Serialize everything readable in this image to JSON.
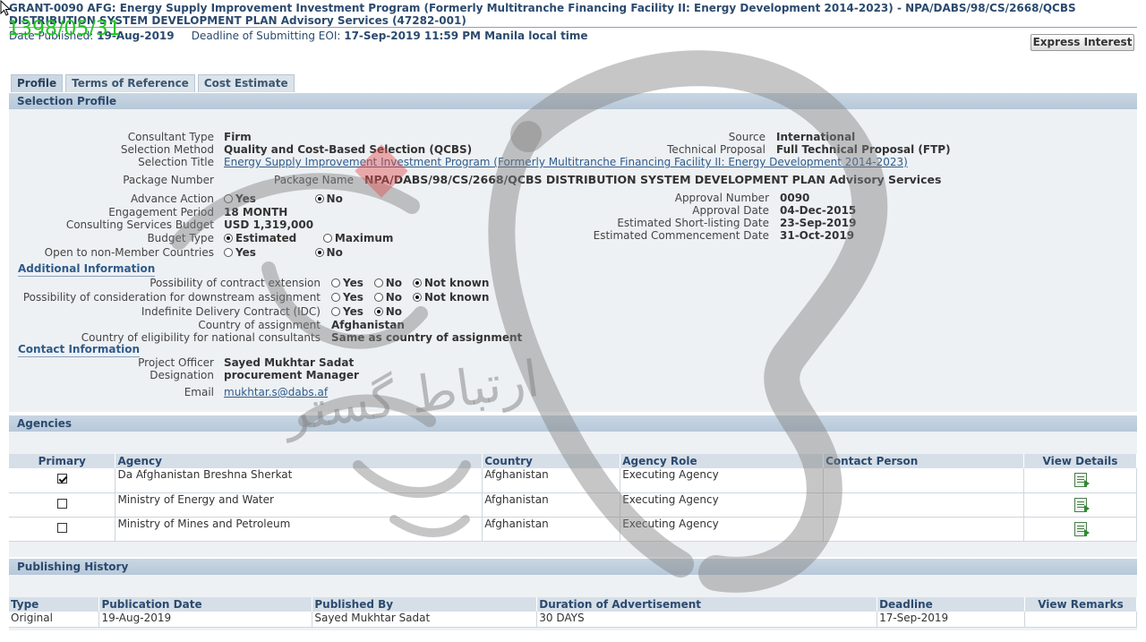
{
  "header": {
    "title": "GRANT-0090 AFG: Energy Supply Improvement Investment Program (Formerly Multitranche Financing Facility II: Energy Development 2014-2023) - NPA/DABS/98/CS/2668/QCBS DISTRIBUTION SYSTEM DEVELOPMENT PLAN Advisory Services (47282-001)",
    "date_published_label": "Date Published:",
    "date_published": "19-Aug-2019",
    "deadline_label": "Deadline of Submitting EOI:",
    "deadline": "17-Sep-2019 11:59 PM Manila local time",
    "express_button": "Express Interest"
  },
  "stamp": "1398/05/31",
  "tabs": [
    "Profile",
    "Terms of Reference",
    "Cost Estimate"
  ],
  "selection_profile": {
    "heading": "Selection Profile",
    "consultant_type_label": "Consultant Type",
    "consultant_type": "Firm",
    "selection_method_label": "Selection Method",
    "selection_method": "Quality and Cost-Based Selection (QCBS)",
    "selection_title_label": "Selection Title",
    "selection_title": "Energy Supply Improvement Investment Program (Formerly Multitranche Financing Facility II: Energy Development 2014-2023)",
    "package_number_label": "Package Number",
    "package_name_label": "Package Name",
    "package_name": "NPA/DABS/98/CS/2668/QCBS DISTRIBUTION SYSTEM DEVELOPMENT PLAN Advisory Services",
    "advance_action_label": "Advance Action",
    "engagement_period_label": "Engagement Period",
    "engagement_period": "18 MONTH",
    "budget_label": "Consulting Services Budget",
    "budget": "USD 1,319,000",
    "budget_type_label": "Budget Type",
    "open_label": "Open to non-Member Countries",
    "source_label": "Source",
    "source": "International",
    "tech_proposal_label": "Technical Proposal",
    "tech_proposal": "Full Technical Proposal (FTP)",
    "approval_number_label": "Approval Number",
    "approval_number": "0090",
    "approval_date_label": "Approval Date",
    "approval_date": "04-Dec-2015",
    "shortlisting_label": "Estimated Short-listing Date",
    "shortlisting_date": "23-Sep-2019",
    "commencement_label": "Estimated Commencement Date",
    "commencement_date": "31-Oct-2019",
    "opt_yes": "Yes",
    "opt_no": "No",
    "opt_estimated": "Estimated",
    "opt_maximum": "Maximum",
    "opt_not_known": "Not known"
  },
  "additional": {
    "heading": "Additional Information",
    "extension_label": "Possibility of contract extension",
    "downstream_label": "Possibility of consideration for downstream assignment",
    "idc_label": "Indefinite Delivery Contract (IDC)",
    "country_label": "Country of assignment",
    "country": "Afghanistan",
    "eligibility_label": "Country of eligibility for national consultants",
    "eligibility": "Same as country of assignment"
  },
  "contact": {
    "heading": "Contact Information",
    "officer_label": "Project Officer",
    "officer": "Sayed Mukhtar Sadat",
    "designation_label": "Designation",
    "designation": "procurement Manager",
    "email_label": "Email",
    "email": "mukhtar.s@dabs.af"
  },
  "agencies": {
    "heading": "Agencies",
    "columns": [
      "Primary",
      "Agency",
      "Country",
      "Agency Role",
      "Contact Person",
      "View Details"
    ],
    "rows": [
      {
        "agency": "Da Afghanistan Breshna Sherkat",
        "country": "Afghanistan",
        "role": "Executing Agency",
        "contact": ""
      },
      {
        "agency": "Ministry of Energy and Water",
        "country": "Afghanistan",
        "role": "Executing Agency",
        "contact": ""
      },
      {
        "agency": "Ministry of Mines and Petroleum",
        "country": "Afghanistan",
        "role": "Executing Agency",
        "contact": ""
      }
    ]
  },
  "history": {
    "heading": "Publishing History",
    "columns": [
      "Type",
      "Publication Date",
      "Published By",
      "Duration of Advertisement",
      "Deadline",
      "View Remarks"
    ],
    "rows": [
      {
        "type": "Original",
        "date": "19-Aug-2019",
        "by": "Sayed Mukhtar Sadat",
        "duration": "30 DAYS",
        "deadline": "17-Sep-2019",
        "remarks": ""
      }
    ]
  },
  "watermark_text": "ارتباط گستر"
}
